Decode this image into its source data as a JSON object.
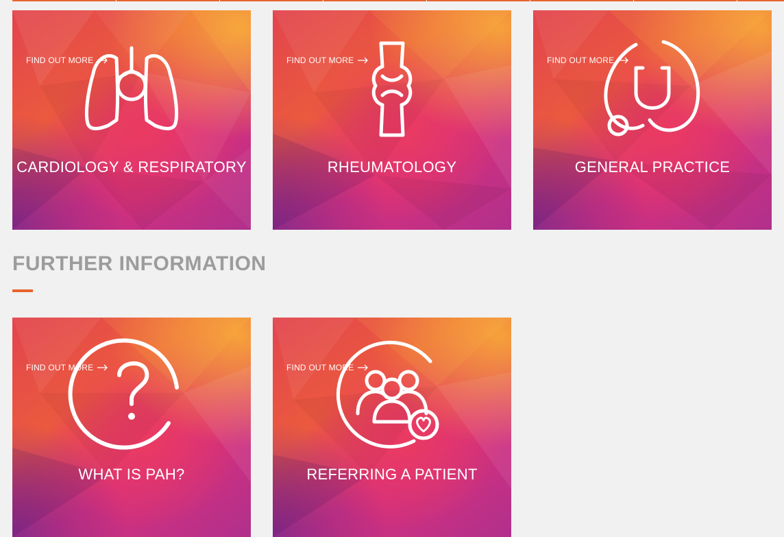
{
  "brand": {
    "accent": "#e8632b"
  },
  "specialties": [
    {
      "title": "CARDIOLOGY & RESPIRATORY",
      "cta": "FIND OUT MORE",
      "icon": "lungs-icon"
    },
    {
      "title": "RHEUMATOLOGY",
      "cta": "FIND OUT MORE",
      "icon": "joint-icon"
    },
    {
      "title": "GENERAL PRACTICE",
      "cta": "FIND OUT MORE",
      "icon": "stethoscope-icon"
    }
  ],
  "further": {
    "heading": "FURTHER INFORMATION",
    "tiles": [
      {
        "title": "WHAT IS PAH?",
        "cta": "FIND OUT MORE",
        "icon": "question-icon"
      },
      {
        "title": "REFERRING A PATIENT",
        "cta": "FIND OUT MORE",
        "icon": "patient-group-icon"
      }
    ]
  }
}
